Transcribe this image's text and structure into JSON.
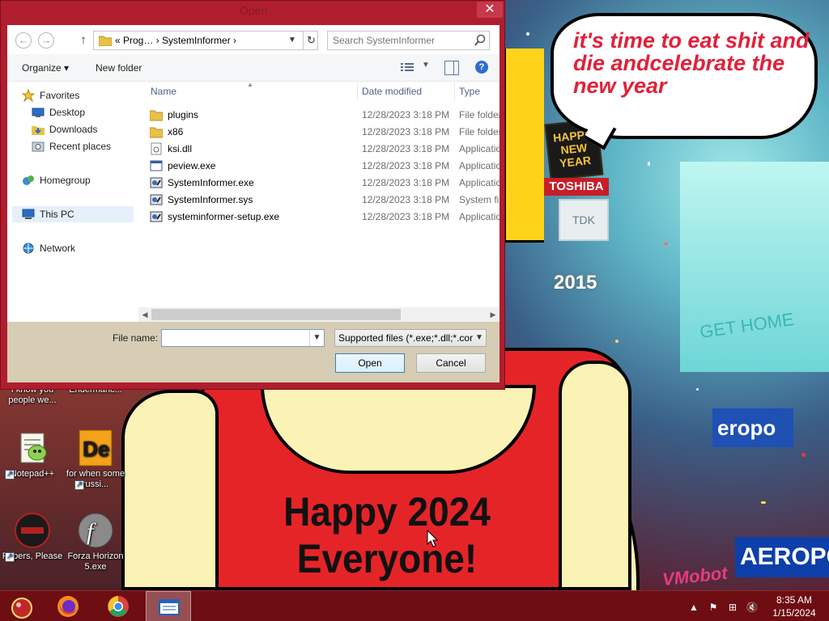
{
  "dialog": {
    "title": "Open",
    "close_label": "✕",
    "address": {
      "path": "«  Prog…  ›  SystemInformer  ›"
    },
    "search": {
      "placeholder": "Search SystemInformer"
    },
    "toolbar": {
      "organize_label": "Organize ▾",
      "new_folder_label": "New folder",
      "help_label": "?"
    },
    "nav_pane": [
      {
        "label": "Favorites",
        "icon": "star-icon",
        "top": "Favorites"
      },
      {
        "label": "Desktop",
        "icon": "desktop-icon"
      },
      {
        "label": "Downloads",
        "icon": "downloads-icon"
      },
      {
        "label": "Recent places",
        "icon": "recent-places-icon"
      },
      {
        "label": "Homegroup",
        "icon": "homegroup-icon"
      },
      {
        "label": "This PC",
        "icon": "this-pc-icon"
      },
      {
        "label": "Network",
        "icon": "network-icon"
      }
    ],
    "columns": {
      "name": "Name",
      "date": "Date modified",
      "type": "Type"
    },
    "files": [
      {
        "name": "plugins",
        "date": "12/28/2023 3:18 PM",
        "type": "File folder",
        "icon": "folder-icon"
      },
      {
        "name": "x86",
        "date": "12/28/2023 3:18 PM",
        "type": "File folder",
        "icon": "folder-icon"
      },
      {
        "name": "ksi.dll",
        "date": "12/28/2023 3:18 PM",
        "type": "Application extension",
        "icon": "dll-file-icon"
      },
      {
        "name": "peview.exe",
        "date": "12/28/2023 3:18 PM",
        "type": "Application",
        "icon": "exe-file-icon"
      },
      {
        "name": "SystemInformer.exe",
        "date": "12/28/2023 3:18 PM",
        "type": "Application",
        "icon": "system-informer-icon"
      },
      {
        "name": "SystemInformer.sys",
        "date": "12/28/2023 3:18 PM",
        "type": "System file",
        "icon": "sys-file-icon"
      },
      {
        "name": "systeminformer-setup.exe",
        "date": "12/28/2023 3:18 PM",
        "type": "Application",
        "icon": "setup-icon"
      }
    ],
    "filename": {
      "label": "File name:",
      "value": ""
    },
    "filetype": {
      "selected": "Supported files (*.exe;*.dll;*.com"
    },
    "buttons": {
      "open": "Open",
      "cancel": "Cancel"
    }
  },
  "desktop": {
    "icons": [
      {
        "label": "I know you people we...",
        "icon": "shortcut-icon"
      },
      {
        "label": "Endermanc...",
        "icon": "shortcut-icon"
      },
      {
        "label": "Notepad++",
        "icon": "notepad-plus-plus-icon"
      },
      {
        "label": "for when some russi...",
        "icon": "de-icon"
      },
      {
        "label": "Papers, Please",
        "icon": "papers-please-icon"
      },
      {
        "label": "Forza Horizon 5.exe",
        "icon": "flash-icon"
      }
    ],
    "wallpaper": {
      "bubble_text": "it's time to eat shit and die andcelebrate the new year",
      "happy_text": "Happy 2024 Everyone!",
      "watermark": "VMobot",
      "signs": {
        "nny": "HAPPY NEW YEAR",
        "toshiba": "TOSHIBA",
        "tdk": "TDK",
        "year": "2015",
        "gethome": "GET HOME",
        "aerop": "eropo",
        "aerop2": "AEROPO"
      }
    }
  },
  "taskbar": {
    "apps": [
      {
        "name": "start-button",
        "icon": "start-orb-icon"
      },
      {
        "name": "firefox",
        "icon": "firefox-icon"
      },
      {
        "name": "chrome",
        "icon": "chrome-icon"
      },
      {
        "name": "file-explorer",
        "icon": "explorer-window-icon",
        "active": true
      }
    ],
    "clock": {
      "time": "8:35 AM",
      "date": "1/15/2024"
    }
  },
  "colors": {
    "titlebar": "#b01e2e",
    "taskbar": "#6e0d12",
    "bubble_text": "#e0213b",
    "link": "#1e3287"
  }
}
